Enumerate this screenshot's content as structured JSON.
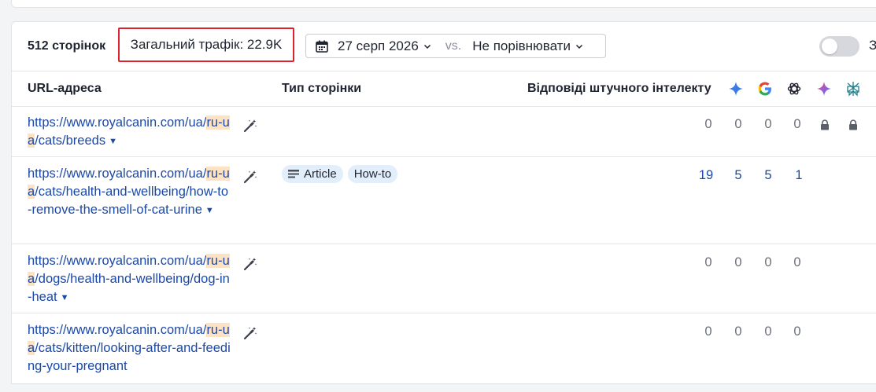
{
  "toolbar": {
    "pages_count": "512 сторінок",
    "traffic": "Загальний трафік: 22.9K",
    "date": "27 серп 2026",
    "vs": "vs.",
    "compare": "Не порівнювати",
    "toggle_label": "З",
    "toggle_on": false
  },
  "headers": {
    "url": "URL-адреса",
    "page_type": "Тип сторінки",
    "ai_answers": "Відповіді штучного інтелекту"
  },
  "engines": [
    "ai-overview-icon",
    "google-icon",
    "chatgpt-icon",
    "gemini-icon",
    "perplexity-icon"
  ],
  "rows": [
    {
      "url_a": "https://www.royalcanin.com/ua/",
      "url_hl": "ru-ua",
      "url_b": "/cats/breeds",
      "tags": [],
      "counts": [
        "0",
        "0",
        "0",
        "0"
      ],
      "locked": true
    },
    {
      "url_a": "https://www.royalcanin.com/ua/",
      "url_hl": "ru-ua",
      "url_b": "/cats/health-and-wellbeing/how-to-remove-the-smell-of-cat-urine",
      "tags": [
        "Article",
        "How-to"
      ],
      "counts": [
        "19",
        "5",
        "5",
        "1"
      ],
      "locked": false
    },
    {
      "url_a": "https://www.royalcanin.com/ua/",
      "url_hl": "ru-ua",
      "url_b": "/dogs/health-and-wellbeing/dog-in-heat",
      "tags": [],
      "counts": [
        "0",
        "0",
        "0",
        "0"
      ],
      "locked": false
    },
    {
      "url_a": "https://www.royalcanin.com/ua/",
      "url_hl": "ru-ua",
      "url_b": "/cats/kitten/looking-after-and-feeding-your-pregnant",
      "tags": [],
      "counts": [
        "0",
        "0",
        "0",
        "0"
      ],
      "locked": false
    }
  ],
  "colors": {
    "link": "#1b49a8",
    "highlight": "#fde3c4",
    "tag_bg": "#e3eefb",
    "annotation_red": "#d9232e"
  }
}
